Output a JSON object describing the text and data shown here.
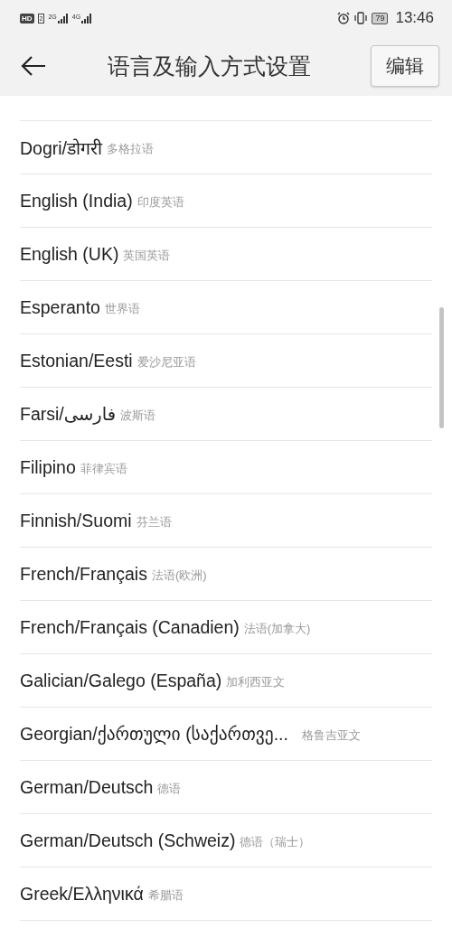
{
  "status_bar": {
    "hd_badge": "HD",
    "sim_badge": "2",
    "networks": [
      "2G",
      "4G"
    ],
    "battery": "79",
    "time": "13:46"
  },
  "header": {
    "title": "语言及输入方式设置",
    "edit_button": "编辑"
  },
  "languages": [
    {
      "name": "Dogri/डोगरी",
      "note": "多格拉语"
    },
    {
      "name": "English (India)",
      "note": "印度英语"
    },
    {
      "name": "English (UK)",
      "note": "英国英语"
    },
    {
      "name": "Esperanto",
      "note": "世界语"
    },
    {
      "name": "Estonian/Eesti",
      "note": "爱沙尼亚语"
    },
    {
      "name": "Farsi/فارسی",
      "note": "波斯语"
    },
    {
      "name": "Filipino",
      "note": "菲律宾语"
    },
    {
      "name": "Finnish/Suomi",
      "note": "芬兰语"
    },
    {
      "name": "French/Français",
      "note": "法语(欧洲)"
    },
    {
      "name": "French/Français (Canadien)",
      "note": "法语(加拿大)"
    },
    {
      "name": "Galician/Galego (España)",
      "note": "加利西亚文"
    },
    {
      "name": "Georgian/ქართული (საქართვე...",
      "note": "格鲁吉亚文"
    },
    {
      "name": "German/Deutsch",
      "note": "德语"
    },
    {
      "name": "German/Deutsch (Schweiz)",
      "note": "德语（瑞士）"
    },
    {
      "name": "Greek/Ελληνικά",
      "note": "希腊语"
    }
  ]
}
